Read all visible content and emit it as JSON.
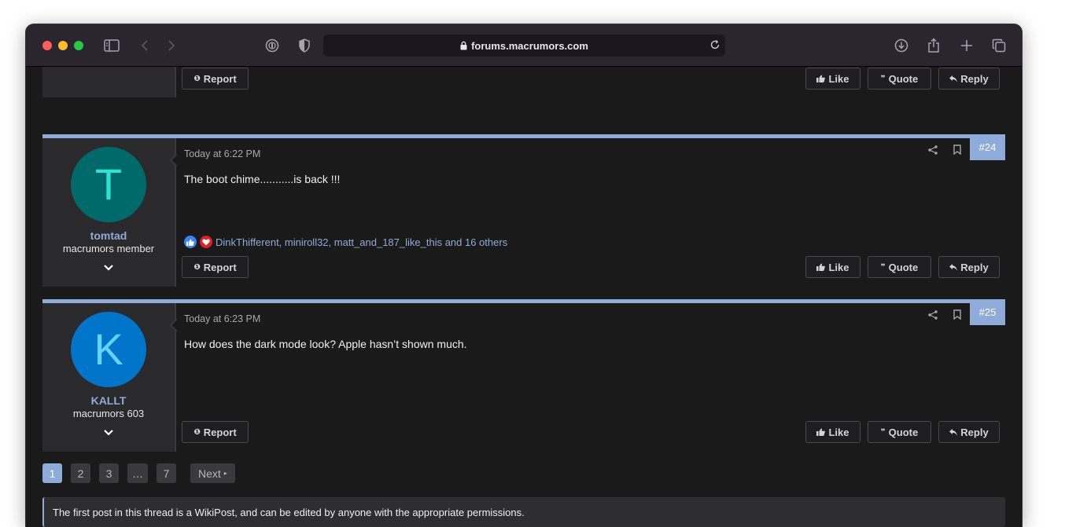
{
  "browser": {
    "url": "forums.macrumors.com"
  },
  "post_buttons": {
    "report": "Report",
    "like": "Like",
    "quote": "Quote",
    "reply": "Reply"
  },
  "posts": [
    {
      "username": "tomtad",
      "user_title": "macrumors member",
      "avatar_letter": "T",
      "avatar_bg": "#006a6b",
      "avatar_fg": "#2de3d4",
      "date": "Today at 6:22 PM",
      "number": "#24",
      "body": "The boot chime...........is back !!!",
      "reactions_text": "DinkThifferent, miniroll32, matt_and_187_like_this and 16 others"
    },
    {
      "username": "KALLT",
      "user_title": "macrumors 603",
      "avatar_letter": "K",
      "avatar_bg": "#0075c9",
      "avatar_fg": "#64d4ff",
      "date": "Today at 6:23 PM",
      "number": "#25",
      "body": "How does the dark mode look? Apple hasn’t shown much."
    }
  ],
  "pagination": {
    "pages": [
      "1",
      "2",
      "3",
      "…",
      "7"
    ],
    "next": "Next"
  },
  "notice": "The first post in this thread is a WikiPost, and can be edited by anyone with the appropriate permissions.",
  "colors": {
    "accent": "#8fabd9",
    "background": "#1a1a1b",
    "toolbar": "#2b2530"
  }
}
